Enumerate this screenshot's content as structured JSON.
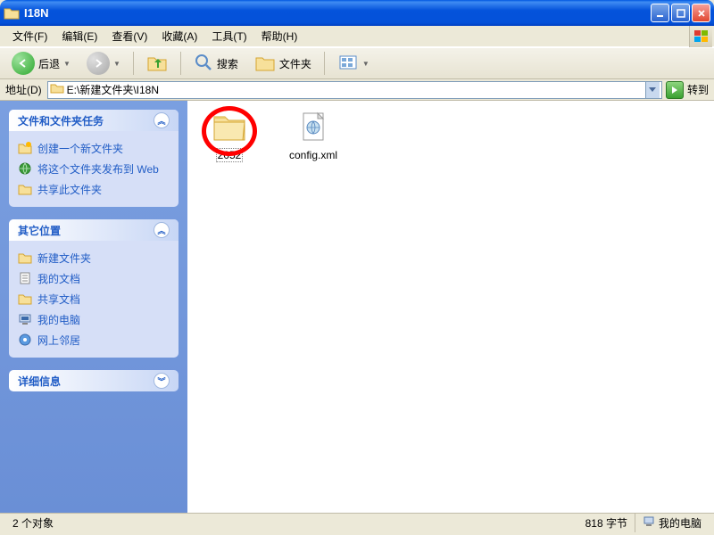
{
  "window": {
    "title": "I18N"
  },
  "menu": {
    "file": "文件(F)",
    "edit": "编辑(E)",
    "view": "查看(V)",
    "favorites": "收藏(A)",
    "tools": "工具(T)",
    "help": "帮助(H)"
  },
  "toolbar": {
    "back": "后退",
    "search": "搜索",
    "folders": "文件夹"
  },
  "address": {
    "label": "地址(D)",
    "path": "E:\\新建文件夹\\I18N",
    "go": "转到"
  },
  "sidebar": {
    "tasks": {
      "title": "文件和文件夹任务",
      "items": [
        "创建一个新文件夹",
        "将这个文件夹发布到 Web",
        "共享此文件夹"
      ]
    },
    "places": {
      "title": "其它位置",
      "items": [
        "新建文件夹",
        "我的文档",
        "共享文档",
        "我的电脑",
        "网上邻居"
      ]
    },
    "details": {
      "title": "详细信息"
    }
  },
  "content": {
    "items": [
      {
        "name": "2052",
        "type": "folder",
        "selected": true
      },
      {
        "name": "config.xml",
        "type": "xml",
        "selected": false
      }
    ]
  },
  "status": {
    "objects": "2 个对象",
    "size": "818 字节",
    "location": "我的电脑"
  }
}
